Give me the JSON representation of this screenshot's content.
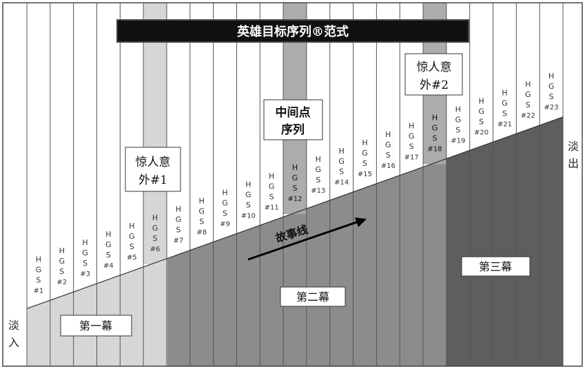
{
  "title": "英雄目标序列®范式",
  "fade_in": [
    "淡",
    "入"
  ],
  "fade_out": [
    "淡",
    "出"
  ],
  "storyline_label": "故事线",
  "acts": [
    {
      "label": "第一幕"
    },
    {
      "label": "第二幕"
    },
    {
      "label": "第三幕"
    }
  ],
  "callouts": [
    {
      "lines": [
        "惊人意",
        "外#1"
      ],
      "column": 6
    },
    {
      "lines": [
        "中间点",
        "序列"
      ],
      "column": 12
    },
    {
      "lines": [
        "惊人意",
        "外#2"
      ],
      "column": 18
    }
  ],
  "highlighted_columns": [
    6,
    12,
    18
  ],
  "sequence_letters": [
    "H",
    "G",
    "S"
  ],
  "sequences": [
    "#1",
    "#2",
    "#3",
    "#4",
    "#5",
    "#6",
    "#7",
    "#8",
    "#9",
    "#10",
    "#11",
    "#12",
    "#13",
    "#14",
    "#15",
    "#16",
    "#17",
    "#18",
    "#19",
    "#20",
    "#21",
    "#22",
    "#23"
  ],
  "colors": {
    "act1": "#d6d6d6",
    "act2": "#8c8c8c",
    "act3": "#5e5e5e",
    "highlight": "#a8a8a8",
    "title_bg": "#111111",
    "title_fg": "#ffffff"
  }
}
